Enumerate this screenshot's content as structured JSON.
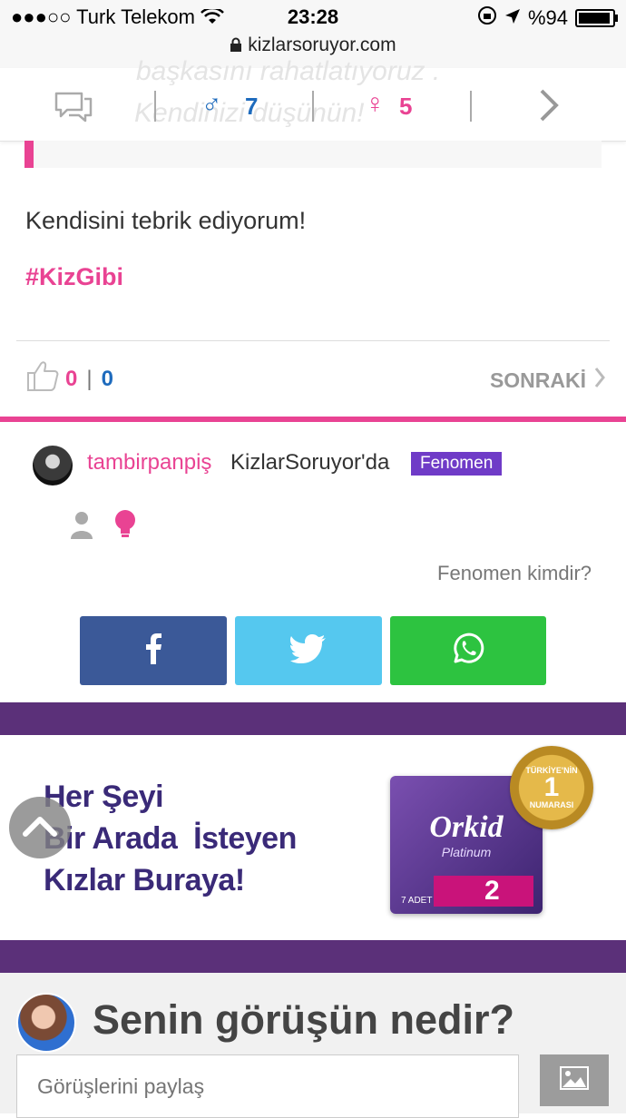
{
  "status_bar": {
    "signal": "●●●○○",
    "carrier": "Turk Telekom",
    "time": "23:28",
    "battery_text": "%94",
    "battery_level": 0.94,
    "url": "kizlarsoruyor.com"
  },
  "toolbar": {
    "male_count": "7",
    "female_count": "5",
    "ghost_line1": "başkasını rahatlatıyoruz .",
    "ghost_line2": "Kendinizi düşünün!"
  },
  "post": {
    "text": "Kendisini tebrik ediyorum!",
    "hashtag": "#KizGibi",
    "likes": "0",
    "dislikes": "0",
    "next_label": "SONRAKİ"
  },
  "author": {
    "username": "tambirpanpiş",
    "site": "KizlarSoruyor'da",
    "badge": "Fenomen",
    "fenomen_link": "Fenomen kimdir?"
  },
  "colors": {
    "pink": "#e94393",
    "blue": "#1e6bbd",
    "facebook": "#3b5998",
    "twitter": "#55c8ef",
    "whatsapp": "#2dc340",
    "purple": "#5b3079"
  },
  "ad": {
    "line1": "Her Şeyi",
    "line2": "Bir Arada  İsteyen",
    "line3": "Kızlar Buraya!",
    "brand": "Orkid",
    "sub": "Platinum",
    "size": "2",
    "count": "7 ADET",
    "seal_top": "TÜRKİYE'NİN",
    "seal_num": "1",
    "seal_bottom": "NUMARASI"
  },
  "comment": {
    "title": "Senin görüşün nedir?",
    "placeholder": "Görüşlerini paylaş"
  }
}
